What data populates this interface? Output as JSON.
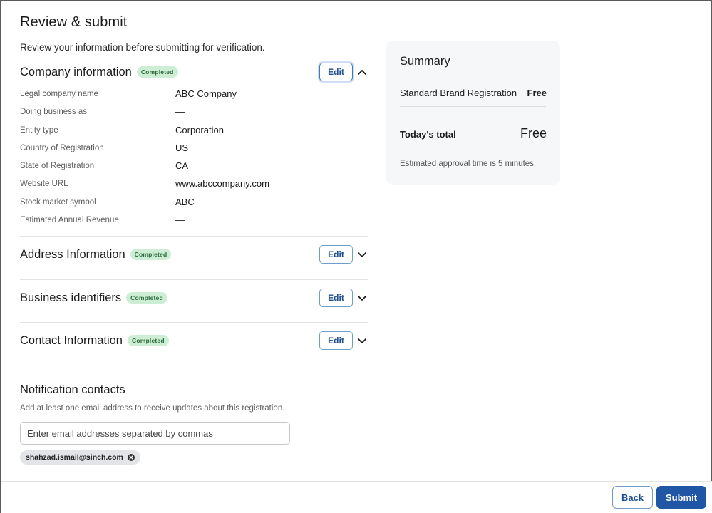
{
  "page": {
    "title": "Review & submit",
    "subtitle": "Review your information before submitting for verification."
  },
  "sections": [
    {
      "title": "Company information",
      "status": "Completed",
      "edit_label": "Edit",
      "expanded": true
    },
    {
      "title": "Address Information",
      "status": "Completed",
      "edit_label": "Edit",
      "expanded": false
    },
    {
      "title": "Business identifiers",
      "status": "Completed",
      "edit_label": "Edit",
      "expanded": false
    },
    {
      "title": "Contact Information",
      "status": "Completed",
      "edit_label": "Edit",
      "expanded": false
    }
  ],
  "company_fields": [
    {
      "label": "Legal company name",
      "value": "ABC Company"
    },
    {
      "label": "Doing business as",
      "value": "—"
    },
    {
      "label": "Entity type",
      "value": "Corporation"
    },
    {
      "label": "Country of Registration",
      "value": "US"
    },
    {
      "label": "State of Registration",
      "value": "CA"
    },
    {
      "label": "Website URL",
      "value": "www.abccompany.com"
    },
    {
      "label": "Stock market symbol",
      "value": "ABC"
    },
    {
      "label": "Estimated Annual Revenue",
      "value": "—"
    }
  ],
  "summary": {
    "title": "Summary",
    "item_label": "Standard Brand Registration",
    "item_price": "Free",
    "total_label": "Today's total",
    "total_price": "Free",
    "note": "Estimated approval time is 5 minutes."
  },
  "notifications": {
    "title": "Notification contacts",
    "description": "Add at least one email address to receive updates about this registration.",
    "placeholder": "Enter email addresses separated by commas",
    "value": "",
    "chips": [
      "shahzad.ismail@sinch.com"
    ]
  },
  "footer": {
    "back_label": "Back",
    "submit_label": "Submit"
  },
  "colors": {
    "primary": "#1f56a6",
    "badge_bg": "#cdeed5",
    "badge_text": "#2b6a3b",
    "summary_bg": "#f6f7f9"
  }
}
